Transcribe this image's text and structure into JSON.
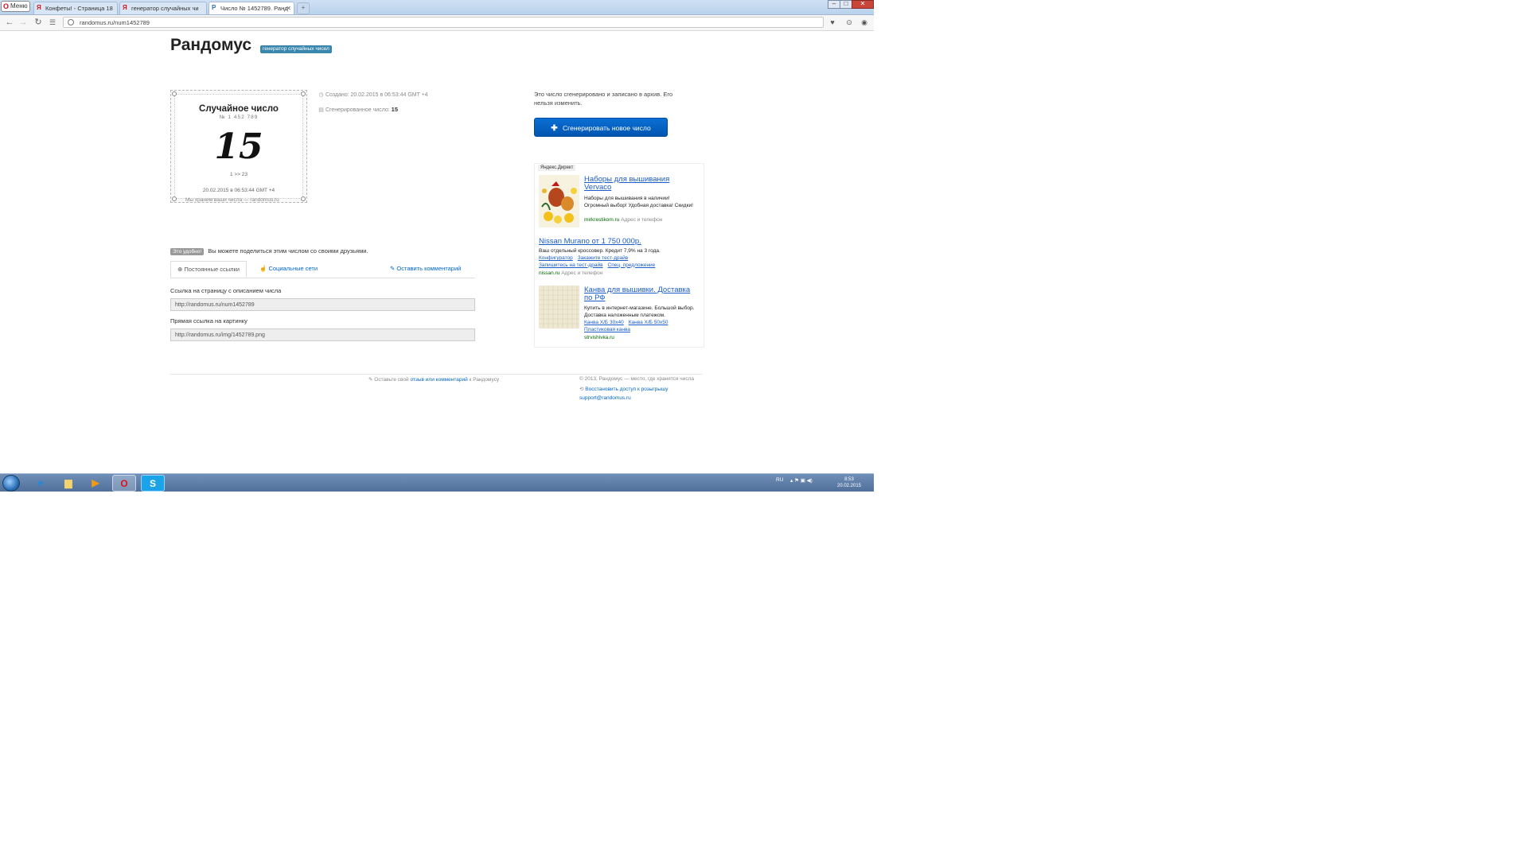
{
  "browser": {
    "menu_label": "Меню",
    "tabs": [
      {
        "label": "Конфеты! - Страница 18",
        "favicon": "Я"
      },
      {
        "label": "генератор случайных чи",
        "favicon": "Я"
      },
      {
        "label": "Число № 1452789. Ранд",
        "favicon": "Р"
      }
    ],
    "url": "randomus.ru/num1452789"
  },
  "site": {
    "title": "Рандомус",
    "badge": "генератор случайных чисел"
  },
  "card": {
    "title": "Случайное число",
    "number_id": "№ 1 452 789",
    "value": "15",
    "range": "1 >> 23",
    "date": "20.02.2015 в 06:53:44 GMT +4",
    "footer": "Мы храним ваши числа — randomus.ru"
  },
  "meta": {
    "created": "Создано: 20.02.2015 в 06:53:44 GMT +4",
    "generated_label": "Сгенерированное число:",
    "generated_value": "15"
  },
  "right": {
    "info": "Это число сгенерировано и записано в архив. Его нельзя изменить.",
    "generate_button": "Сгенерировать новое число"
  },
  "ad": {
    "label": "Яндекс.Директ",
    "items": [
      {
        "title": "Наборы для вышивания Vervaco",
        "body": "Наборы для вышивания в наличии! Огромный выбор! Удобная доставка! Скидки!",
        "host": "mirkrestikom.ru",
        "extra": "Адрес и телефон"
      },
      {
        "title": "Nissan Murano от 1 750 000р.",
        "body": "Ваш отдельный кроссовер. Кредит 7,9% на 3 года.",
        "links": [
          "Конфигуратор",
          "Закажите тест-драйв",
          "Запишитесь на тест-драйв",
          "Спец. предложение"
        ],
        "host": "nissan.ru",
        "extra": "Адрес и телефон"
      },
      {
        "title": "Канва для вышивки. Доставка по РФ",
        "body": "Купить в интернет-магазине. Большой выбор. Доставка наложенным платежом.",
        "links": [
          "Канва Х/Б 30х40",
          "Канва Х/Б 50х50",
          "Пластиковая канва"
        ],
        "host": "strvishivka.ru",
        "extra": ""
      }
    ]
  },
  "share": {
    "badge": "Это удобно!",
    "text": "Вы можете поделиться этим числом со своими друзьями.",
    "tabs": [
      "Постоянные ссылки",
      "Социальные сети"
    ],
    "comment_link": "Оставить комментарий",
    "page_link_label": "Ссылка на страницу с описанием числа",
    "page_link_value": "http://randomus.ru/num1452789",
    "img_link_label": "Прямая ссылка на картинку",
    "img_link_value": "http://randomus.ru/img/1452789.png"
  },
  "footer": {
    "left_prefix": "Оставьте свой",
    "left_link": "отзыв или комментарий",
    "left_suffix": "к Рандомусу",
    "copyright": "© 2013, Рандомус — место, где хранятся числа",
    "restore": "Восстановить доступ к розыгрышу",
    "email": "support@randomus.ru"
  },
  "taskbar": {
    "lang": "RU",
    "time": "8:53",
    "date": "20.02.2015"
  },
  "colors": {
    "accent": "#0b6fd4",
    "badge": "#3a87ad",
    "link": "#1a5cc8"
  }
}
